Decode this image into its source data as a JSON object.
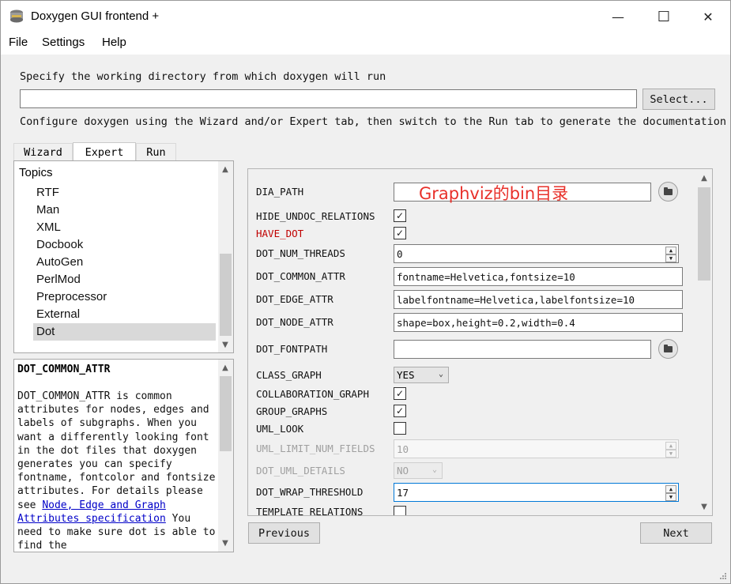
{
  "window": {
    "title": "Doxygen GUI frontend +",
    "controls": {
      "minimize": "—",
      "maximize": "☐",
      "close": "✕"
    }
  },
  "menu": [
    "File",
    "Settings",
    "Help"
  ],
  "workdir": {
    "prompt": "Specify the working directory from which doxygen will run",
    "value": "",
    "select_button": "Select...",
    "hint": "Configure doxygen using the Wizard and/or Expert tab, then switch to the Run tab to generate the documentation"
  },
  "tabs": [
    {
      "label": "Wizard",
      "active": false
    },
    {
      "label": "Expert",
      "active": true
    },
    {
      "label": "Run",
      "active": false
    }
  ],
  "topics": {
    "header": "Topics",
    "items": [
      "RTF",
      "Man",
      "XML",
      "Docbook",
      "AutoGen",
      "PerlMod",
      "Preprocessor",
      "External",
      "Dot"
    ],
    "selected": "Dot"
  },
  "help": {
    "title": "DOT_COMMON_ATTR",
    "term": "DOT_COMMON_ATTR",
    "text1": " is common attributes for nodes, edges and labels of subgraphs. When you want a differently looking font in the dot files that doxygen generates you can specify fontname, fontcolor and fontsize attributes. For details please see ",
    "link": "Node, Edge and Graph Attributes specification",
    "text2": " You need to make sure dot is able to find the"
  },
  "annotation": "Graphviz的bin目录",
  "options": {
    "dia_path": {
      "label": "DIA_PATH",
      "value": ""
    },
    "hide_undoc_relations": {
      "label": "HIDE_UNDOC_RELATIONS",
      "checked": true
    },
    "have_dot": {
      "label": "HAVE_DOT",
      "checked": true
    },
    "dot_num_threads": {
      "label": "DOT_NUM_THREADS",
      "value": "0"
    },
    "dot_common_attr": {
      "label": "DOT_COMMON_ATTR",
      "value": "fontname=Helvetica,fontsize=10"
    },
    "dot_edge_attr": {
      "label": "DOT_EDGE_ATTR",
      "value": "labelfontname=Helvetica,labelfontsize=10"
    },
    "dot_node_attr": {
      "label": "DOT_NODE_ATTR",
      "value": "shape=box,height=0.2,width=0.4"
    },
    "dot_fontpath": {
      "label": "DOT_FONTPATH",
      "value": ""
    },
    "class_graph": {
      "label": "CLASS_GRAPH",
      "value": "YES"
    },
    "collaboration_graph": {
      "label": "COLLABORATION_GRAPH",
      "checked": true
    },
    "group_graphs": {
      "label": "GROUP_GRAPHS",
      "checked": true
    },
    "uml_look": {
      "label": "UML_LOOK",
      "checked": false
    },
    "uml_limit_num_fields": {
      "label": "UML_LIMIT_NUM_FIELDS",
      "value": "10"
    },
    "dot_uml_details": {
      "label": "DOT_UML_DETAILS",
      "value": "NO"
    },
    "dot_wrap_threshold": {
      "label": "DOT_WRAP_THRESHOLD",
      "value": "17"
    },
    "template_relations": {
      "label": "TEMPLATE_RELATIONS",
      "checked": false
    }
  },
  "nav": {
    "previous": "Previous",
    "next": "Next"
  },
  "colors": {
    "have_dot_label": "#c00000",
    "annotation": "#e8302a",
    "link": "#0000c8"
  }
}
